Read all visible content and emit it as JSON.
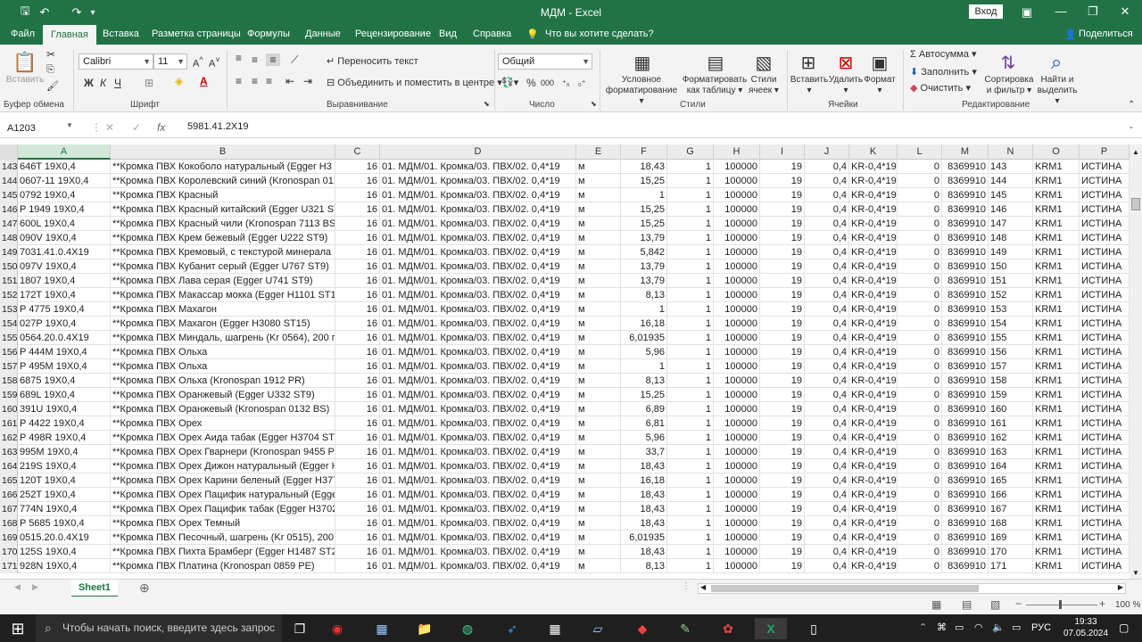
{
  "window": {
    "title": "МДМ - Excel",
    "login": "Вход"
  },
  "tabs": [
    "Файл",
    "Главная",
    "Вставка",
    "Разметка страницы",
    "Формулы",
    "Данные",
    "Рецензирование",
    "Вид",
    "Справка"
  ],
  "tell_me": "Что вы хотите сделать?",
  "share": "Поделиться",
  "ribbon": {
    "paste": "Вставить",
    "clipboard": "Буфер обмена",
    "font_name": "Calibri",
    "font_size": "11",
    "font_group": "Шрифт",
    "wrap": "Переносить текст",
    "merge": "Объединить и поместить в центре",
    "align_group": "Выравнивание",
    "number_format": "Общий",
    "number_group": "Число",
    "cond_format": "Условное",
    "cond_format2": "форматирование",
    "format_table": "Форматировать",
    "format_table2": "как таблицу",
    "cell_styles": "Стили",
    "cell_styles2": "ячеек",
    "styles_group": "Стили",
    "insert": "Вставить",
    "delete": "Удалить",
    "format": "Формат",
    "cells_group": "Ячейки",
    "autosum": "Автосумма",
    "fill": "Заполнить",
    "clear": "Очистить",
    "sort": "Сортировка",
    "sort2": "и фильтр",
    "find": "Найти и",
    "find2": "выделить",
    "edit_group": "Редактирование"
  },
  "formula_bar": {
    "name_box": "A1203",
    "formula": "5981.41.2X19"
  },
  "columns": [
    "A",
    "B",
    "C",
    "D",
    "E",
    "F",
    "G",
    "H",
    "I",
    "J",
    "K",
    "L",
    "M",
    "N",
    "O",
    "P"
  ],
  "rows": [
    {
      "n": "143",
      "a": "646T 19X0,4",
      "b": "**Кромка ПВХ Кокоболо натуральный   (Egger H3",
      "c": "16",
      "d": "01. МДМ/01. Кромка/03. ПВХ/02. 0,4*19",
      "e": "м",
      "f": "18,43",
      "g": "1",
      "h": "100000",
      "i": "19",
      "j": "0,4",
      "k": "KR-0,4*19",
      "l": "0",
      "m": "8369910",
      "o": "KRM1",
      "p": "ИСТИНА"
    },
    {
      "n": "144",
      "a": "0607-11 19X0,4",
      "b": "**Кромка ПВХ Королевский синий (Kronospan 01:",
      "c": "16",
      "d": "01. МДМ/01. Кромка/03. ПВХ/02. 0,4*19",
      "e": "м",
      "f": "15,25",
      "g": "1",
      "h": "100000",
      "i": "19",
      "j": "0,4",
      "k": "KR-0,4*19",
      "l": "0",
      "m": "8369910",
      "o": "KRM1",
      "p": "ИСТИНА"
    },
    {
      "n": "145",
      "a": "0792 19X0,4",
      "b": "**Кромка ПВХ Красный",
      "c": "16",
      "d": "01. МДМ/01. Кромка/03. ПВХ/02. 0,4*19",
      "e": "м",
      "f": "1",
      "g": "1",
      "h": "100000",
      "i": "19",
      "j": "0,4",
      "k": "KR-0,4*19",
      "l": "0",
      "m": "8369910",
      "o": "KRM1",
      "p": "ИСТИНА"
    },
    {
      "n": "146",
      "a": "P 1949 19X0,4",
      "b": "**Кромка ПВХ Красный китайский (Egger U321 ST9",
      "c": "16",
      "d": "01. МДМ/01. Кромка/03. ПВХ/02. 0,4*19",
      "e": "м",
      "f": "15,25",
      "g": "1",
      "h": "100000",
      "i": "19",
      "j": "0,4",
      "k": "KR-0,4*19",
      "l": "0",
      "m": "8369910",
      "o": "KRM1",
      "p": "ИСТИНА"
    },
    {
      "n": "147",
      "a": "600L 19X0,4",
      "b": "**Кромка ПВХ Красный чили (Kronospan 7113 BS)",
      "c": "16",
      "d": "01. МДМ/01. Кромка/03. ПВХ/02. 0,4*19",
      "e": "м",
      "f": "15,25",
      "g": "1",
      "h": "100000",
      "i": "19",
      "j": "0,4",
      "k": "KR-0,4*19",
      "l": "0",
      "m": "8369910",
      "o": "KRM1",
      "p": "ИСТИНА"
    },
    {
      "n": "148",
      "a": "090V 19X0,4",
      "b": "**Кромка ПВХ Крем бежевый (Egger U222 ST9)",
      "c": "16",
      "d": "01. МДМ/01. Кромка/03. ПВХ/02. 0,4*19",
      "e": "м",
      "f": "13,79",
      "g": "1",
      "h": "100000",
      "i": "19",
      "j": "0,4",
      "k": "KR-0,4*19",
      "l": "0",
      "m": "8369910",
      "o": "KRM1",
      "p": "ИСТИНА"
    },
    {
      "n": "149",
      "a": "7031.41.0.4X19",
      "b": "**Кромка ПВХ Кремовый, с текстурой минерала",
      "c": "16",
      "d": "01. МДМ/01. Кромка/03. ПВХ/02. 0,4*19",
      "e": "м",
      "f": "5,842",
      "g": "1",
      "h": "100000",
      "i": "19",
      "j": "0,4",
      "k": "KR-0,4*19",
      "l": "0",
      "m": "8369910",
      "o": "KRM1",
      "p": "ИСТИНА"
    },
    {
      "n": "150",
      "a": "097V 19X0,4",
      "b": "**Кромка ПВХ Кубанит серый (Egger U767 ST9)",
      "c": "16",
      "d": "01. МДМ/01. Кромка/03. ПВХ/02. 0,4*19",
      "e": "м",
      "f": "13,79",
      "g": "1",
      "h": "100000",
      "i": "19",
      "j": "0,4",
      "k": "KR-0,4*19",
      "l": "0",
      "m": "8369910",
      "o": "KRM1",
      "p": "ИСТИНА"
    },
    {
      "n": "151",
      "a": "1807 19X0,4",
      "b": "**Кромка ПВХ Лава серая (Egger U741 ST9)",
      "c": "16",
      "d": "01. МДМ/01. Кромка/03. ПВХ/02. 0,4*19",
      "e": "м",
      "f": "13,79",
      "g": "1",
      "h": "100000",
      "i": "19",
      "j": "0,4",
      "k": "KR-0,4*19",
      "l": "0",
      "m": "8369910",
      "o": "KRM1",
      "p": "ИСТИНА"
    },
    {
      "n": "152",
      "a": "172T 19X0,4",
      "b": "**Кромка ПВХ Макассар мокка (Egger H1101 ST12)",
      "c": "16",
      "d": "01. МДМ/01. Кромка/03. ПВХ/02. 0,4*19",
      "e": "м",
      "f": "8,13",
      "g": "1",
      "h": "100000",
      "i": "19",
      "j": "0,4",
      "k": "KR-0,4*19",
      "l": "0",
      "m": "8369910",
      "o": "KRM1",
      "p": "ИСТИНА"
    },
    {
      "n": "153",
      "a": "P 4775 19X0,4",
      "b": "**Кромка ПВХ Махагон",
      "c": "16",
      "d": "01. МДМ/01. Кромка/03. ПВХ/02. 0,4*19",
      "e": "м",
      "f": "1",
      "g": "1",
      "h": "100000",
      "i": "19",
      "j": "0,4",
      "k": "KR-0,4*19",
      "l": "0",
      "m": "8369910",
      "o": "KRM1",
      "p": "ИСТИНА"
    },
    {
      "n": "154",
      "a": "027P 19X0,4",
      "b": "**Кромка ПВХ Махагон (Egger H3080 ST15)",
      "c": "16",
      "d": "01. МДМ/01. Кромка/03. ПВХ/02. 0,4*19",
      "e": "м",
      "f": "16,18",
      "g": "1",
      "h": "100000",
      "i": "19",
      "j": "0,4",
      "k": "KR-0,4*19",
      "l": "0",
      "m": "8369910",
      "o": "KRM1",
      "p": "ИСТИНА"
    },
    {
      "n": "155",
      "a": "0564.20.0.4X19",
      "b": "**Кромка ПВХ Миндаль, шагрень (Kr 0564), 200 по",
      "c": "16",
      "d": "01. МДМ/01. Кромка/03. ПВХ/02. 0,4*19",
      "e": "м",
      "f": "6,01935",
      "g": "1",
      "h": "100000",
      "i": "19",
      "j": "0,4",
      "k": "KR-0,4*19",
      "l": "0",
      "m": "8369910",
      "o": "KRM1",
      "p": "ИСТИНА"
    },
    {
      "n": "156",
      "a": "P 444M 19X0,4",
      "b": "**Кромка ПВХ Ольха",
      "c": "16",
      "d": "01. МДМ/01. Кромка/03. ПВХ/02. 0,4*19",
      "e": "м",
      "f": "5,96",
      "g": "1",
      "h": "100000",
      "i": "19",
      "j": "0,4",
      "k": "KR-0,4*19",
      "l": "0",
      "m": "8369910",
      "o": "KRM1",
      "p": "ИСТИНА"
    },
    {
      "n": "157",
      "a": "P 495M 19X0,4",
      "b": "**Кромка ПВХ Ольха",
      "c": "16",
      "d": "01. МДМ/01. Кромка/03. ПВХ/02. 0,4*19",
      "e": "м",
      "f": "1",
      "g": "1",
      "h": "100000",
      "i": "19",
      "j": "0,4",
      "k": "KR-0,4*19",
      "l": "0",
      "m": "8369910",
      "o": "KRM1",
      "p": "ИСТИНА"
    },
    {
      "n": "158",
      "a": "6875 19X0,4",
      "b": "**Кромка ПВХ Ольха (Kronospan 1912 PR)",
      "c": "16",
      "d": "01. МДМ/01. Кромка/03. ПВХ/02. 0,4*19",
      "e": "м",
      "f": "8,13",
      "g": "1",
      "h": "100000",
      "i": "19",
      "j": "0,4",
      "k": "KR-0,4*19",
      "l": "0",
      "m": "8369910",
      "o": "KRM1",
      "p": "ИСТИНА"
    },
    {
      "n": "159",
      "a": "689L 19X0,4",
      "b": "**Кромка ПВХ Оранжевый (Egger U332 ST9)",
      "c": "16",
      "d": "01. МДМ/01. Кромка/03. ПВХ/02. 0,4*19",
      "e": "м",
      "f": "15,25",
      "g": "1",
      "h": "100000",
      "i": "19",
      "j": "0,4",
      "k": "KR-0,4*19",
      "l": "0",
      "m": "8369910",
      "o": "KRM1",
      "p": "ИСТИНА"
    },
    {
      "n": "160",
      "a": "391U 19X0,4",
      "b": "**Кромка ПВХ Оранжевый (Kronospan 0132 BS)",
      "c": "16",
      "d": "01. МДМ/01. Кромка/03. ПВХ/02. 0,4*19",
      "e": "м",
      "f": "6,89",
      "g": "1",
      "h": "100000",
      "i": "19",
      "j": "0,4",
      "k": "KR-0,4*19",
      "l": "0",
      "m": "8369910",
      "o": "KRM1",
      "p": "ИСТИНА"
    },
    {
      "n": "161",
      "a": "P 4422 19X0,4",
      "b": "**Кромка ПВХ Орех",
      "c": "16",
      "d": "01. МДМ/01. Кромка/03. ПВХ/02. 0,4*19",
      "e": "м",
      "f": "6,81",
      "g": "1",
      "h": "100000",
      "i": "19",
      "j": "0,4",
      "k": "KR-0,4*19",
      "l": "0",
      "m": "8369910",
      "o": "KRM1",
      "p": "ИСТИНА"
    },
    {
      "n": "162",
      "a": "P 498R 19X0,4",
      "b": "**Кромка ПВХ Орех Аида табак (Egger H3704 ST15",
      "c": "16",
      "d": "01. МДМ/01. Кромка/03. ПВХ/02. 0,4*19",
      "e": "м",
      "f": "5,96",
      "g": "1",
      "h": "100000",
      "i": "19",
      "j": "0,4",
      "k": "KR-0,4*19",
      "l": "0",
      "m": "8369910",
      "o": "KRM1",
      "p": "ИСТИНА"
    },
    {
      "n": "163",
      "a": "995M 19X0,4",
      "b": "**Кромка ПВХ Орех Гварнери (Kronospan 9455 PR",
      "c": "16",
      "d": "01. МДМ/01. Кромка/03. ПВХ/02. 0,4*19",
      "e": "м",
      "f": "33,7",
      "g": "1",
      "h": "100000",
      "i": "19",
      "j": "0,4",
      "k": "KR-0,4*19",
      "l": "0",
      "m": "8369910",
      "o": "KRM1",
      "p": "ИСТИНА"
    },
    {
      "n": "164",
      "a": "219S 19X0,4",
      "b": "**Кромка ПВХ Орех Дижон натуральный (Egger H",
      "c": "16",
      "d": "01. МДМ/01. Кромка/03. ПВХ/02. 0,4*19",
      "e": "м",
      "f": "18,43",
      "g": "1",
      "h": "100000",
      "i": "19",
      "j": "0,4",
      "k": "KR-0,4*19",
      "l": "0",
      "m": "8369910",
      "o": "KRM1",
      "p": "ИСТИНА"
    },
    {
      "n": "165",
      "a": "120T 19X0,4",
      "b": "**Кромка ПВХ Орех Карини беленый (Egger H377",
      "c": "16",
      "d": "01. МДМ/01. Кромка/03. ПВХ/02. 0,4*19",
      "e": "м",
      "f": "16,18",
      "g": "1",
      "h": "100000",
      "i": "19",
      "j": "0,4",
      "k": "KR-0,4*19",
      "l": "0",
      "m": "8369910",
      "o": "KRM1",
      "p": "ИСТИНА"
    },
    {
      "n": "166",
      "a": "252T 19X0,4",
      "b": "**Кромка ПВХ Орех Пацифик натуральный (Egge",
      "c": "16",
      "d": "01. МДМ/01. Кромка/03. ПВХ/02. 0,4*19",
      "e": "м",
      "f": "18,43",
      "g": "1",
      "h": "100000",
      "i": "19",
      "j": "0,4",
      "k": "KR-0,4*19",
      "l": "0",
      "m": "8369910",
      "o": "KRM1",
      "p": "ИСТИНА"
    },
    {
      "n": "167",
      "a": "774N 19X0,4",
      "b": "**Кромка ПВХ Орех Пацифик табак  (Egger H3702",
      "c": "16",
      "d": "01. МДМ/01. Кромка/03. ПВХ/02. 0,4*19",
      "e": "м",
      "f": "18,43",
      "g": "1",
      "h": "100000",
      "i": "19",
      "j": "0,4",
      "k": "KR-0,4*19",
      "l": "0",
      "m": "8369910",
      "o": "KRM1",
      "p": "ИСТИНА"
    },
    {
      "n": "168",
      "a": "P 5685 19X0,4",
      "b": "**Кромка ПВХ Орех Темный",
      "c": "16",
      "d": "01. МДМ/01. Кромка/03. ПВХ/02. 0,4*19",
      "e": "м",
      "f": "18,43",
      "g": "1",
      "h": "100000",
      "i": "19",
      "j": "0,4",
      "k": "KR-0,4*19",
      "l": "0",
      "m": "8369910",
      "o": "KRM1",
      "p": "ИСТИНА"
    },
    {
      "n": "169",
      "a": "0515.20.0.4X19",
      "b": "**Кромка ПВХ Песочный, шагрень (Kr 0515), 200 п",
      "c": "16",
      "d": "01. МДМ/01. Кромка/03. ПВХ/02. 0,4*19",
      "e": "м",
      "f": "6,01935",
      "g": "1",
      "h": "100000",
      "i": "19",
      "j": "0,4",
      "k": "KR-0,4*19",
      "l": "0",
      "m": "8369910",
      "o": "KRM1",
      "p": "ИСТИНА"
    },
    {
      "n": "170",
      "a": "125S 19X0,4",
      "b": "**Кромка ПВХ Пихта Брамберг (Egger H1487 ST22)",
      "c": "16",
      "d": "01. МДМ/01. Кромка/03. ПВХ/02. 0,4*19",
      "e": "м",
      "f": "18,43",
      "g": "1",
      "h": "100000",
      "i": "19",
      "j": "0,4",
      "k": "KR-0,4*19",
      "l": "0",
      "m": "8369910",
      "o": "KRM1",
      "p": "ИСТИНА"
    },
    {
      "n": "171",
      "a": "928N 19X0,4",
      "b": "**Кромка ПВХ Платина (Kronospan 0859 PE)",
      "c": "16",
      "d": "01. МДМ/01. Кромка/03. ПВХ/02. 0,4*19",
      "e": "м",
      "f": "8,13",
      "g": "1",
      "h": "100000",
      "i": "19",
      "j": "0,4",
      "k": "KR-0,4*19",
      "l": "0",
      "m": "8369910",
      "o": "KRM1",
      "p": "ИСТИНА"
    }
  ],
  "sheet": {
    "name": "Sheet1"
  },
  "status": {
    "zoom": "100 %"
  },
  "taskbar": {
    "search": "Чтобы начать поиск, введите здесь запрос",
    "lang": "РУС",
    "time": "19:33",
    "date": "07.05.2024"
  }
}
